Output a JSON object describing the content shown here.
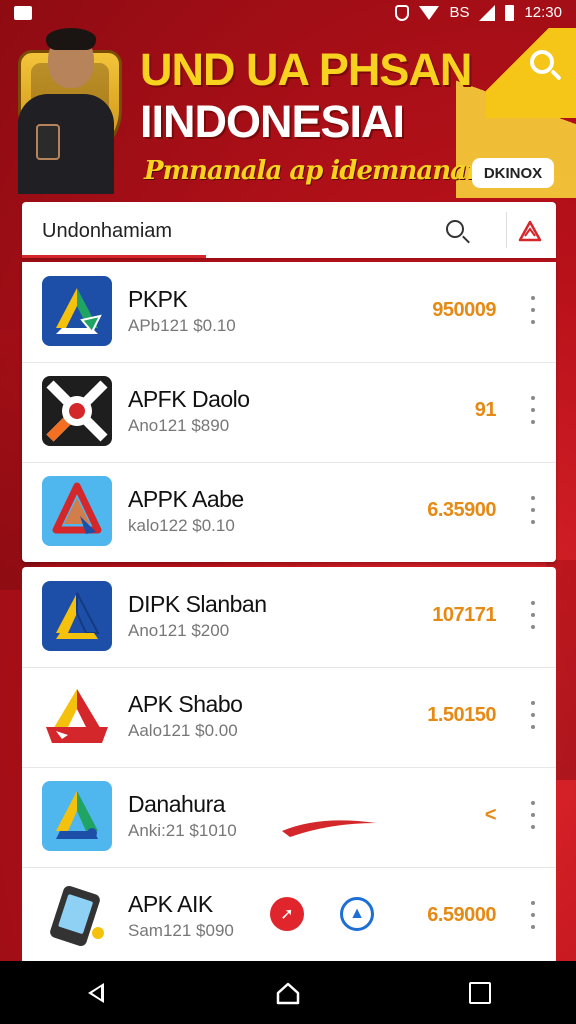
{
  "status_bar": {
    "network": "BS",
    "time": "12:30"
  },
  "banner": {
    "title_line1": "UND UA PHSAN",
    "title_line2": "IINDONESIAI",
    "tagline": "Pmnanala ap idemnanana.",
    "pill": "DKINOX"
  },
  "search": {
    "query": "Undonhamiam"
  },
  "apps": [
    {
      "name": "PKPK",
      "sub": "APb121  $0.10",
      "value": "950009"
    },
    {
      "name": "APFK Daolo",
      "sub": "Ano121  $890",
      "value": "91"
    },
    {
      "name": "APPK Aabe",
      "sub": "kalo122  $0.10",
      "value": "6.35900"
    },
    {
      "name": "DIPK Slanban",
      "sub": "Ano121  $200",
      "value": "107171"
    },
    {
      "name": "APK Shabo",
      "sub": "Aalo121  $0.00",
      "value": "1.50150"
    },
    {
      "name": "Danahura",
      "sub": "Anki:21  $1010",
      "value": "<"
    },
    {
      "name": "APK AIK",
      "sub": "Sam121  $090",
      "value": "6.59000"
    }
  ],
  "colors": {
    "brand_red": "#d3272b",
    "accent_yellow": "#f7d21f",
    "value_orange": "#e58a15"
  }
}
